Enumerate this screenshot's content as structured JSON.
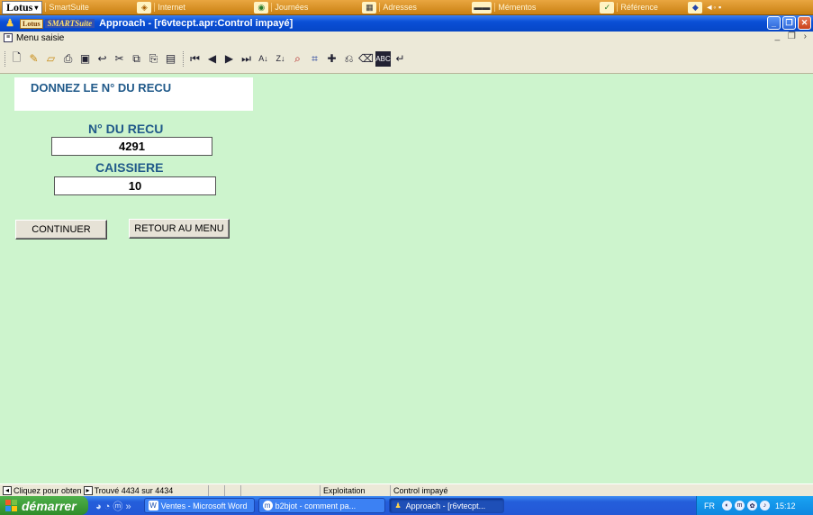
{
  "suitebar": {
    "logo": "Lotus",
    "items": [
      {
        "label": "SmartSuite",
        "icon": "smartsuite-icon"
      },
      {
        "label": "Internet",
        "icon": "internet-icon"
      },
      {
        "label": "Journées",
        "icon": "journees-icon"
      },
      {
        "label": "Adresses",
        "icon": "adresses-icon"
      },
      {
        "label": "Mémentos",
        "icon": "mementos-icon"
      },
      {
        "label": "Référence",
        "icon": "reference-icon"
      }
    ]
  },
  "window": {
    "lotus_badge": "Lotus",
    "smart_badge": "SMARTSuite",
    "title": "Approach - [r6vtecpt.apr:Control impayé]"
  },
  "menu": {
    "label": "Menu saisie"
  },
  "form": {
    "prompt": "DONNEZ LE N° DU RECU",
    "recu_label": "N° DU RECU",
    "recu_value": "4291",
    "caissiere_label": "CAISSIERE",
    "caissiere_value": "10",
    "continue_button": "CONTINUER",
    "menu_button": "RETOUR AU MENU"
  },
  "statusbar": {
    "hint": "Cliquez pour obten",
    "found": "Trouvé 4434 sur 4434",
    "mode": "Exploitation",
    "view": "Control impayé"
  },
  "taskbar": {
    "start": "démarrer",
    "tasks": [
      {
        "label": "Ventes - Microsoft Word",
        "icon": "word-icon"
      },
      {
        "label": "b2bjot - comment pa...",
        "icon": "browser-icon"
      },
      {
        "label": "Approach - [r6vtecpt...",
        "icon": "approach-icon"
      }
    ],
    "lang": "FR",
    "clock": "15:12"
  },
  "colors": {
    "form_background": "#cdf4cd",
    "label_blue": "#215a8a",
    "titlebar_blue": "#0a4fd6",
    "suitebar_orange": "#e9a640"
  }
}
